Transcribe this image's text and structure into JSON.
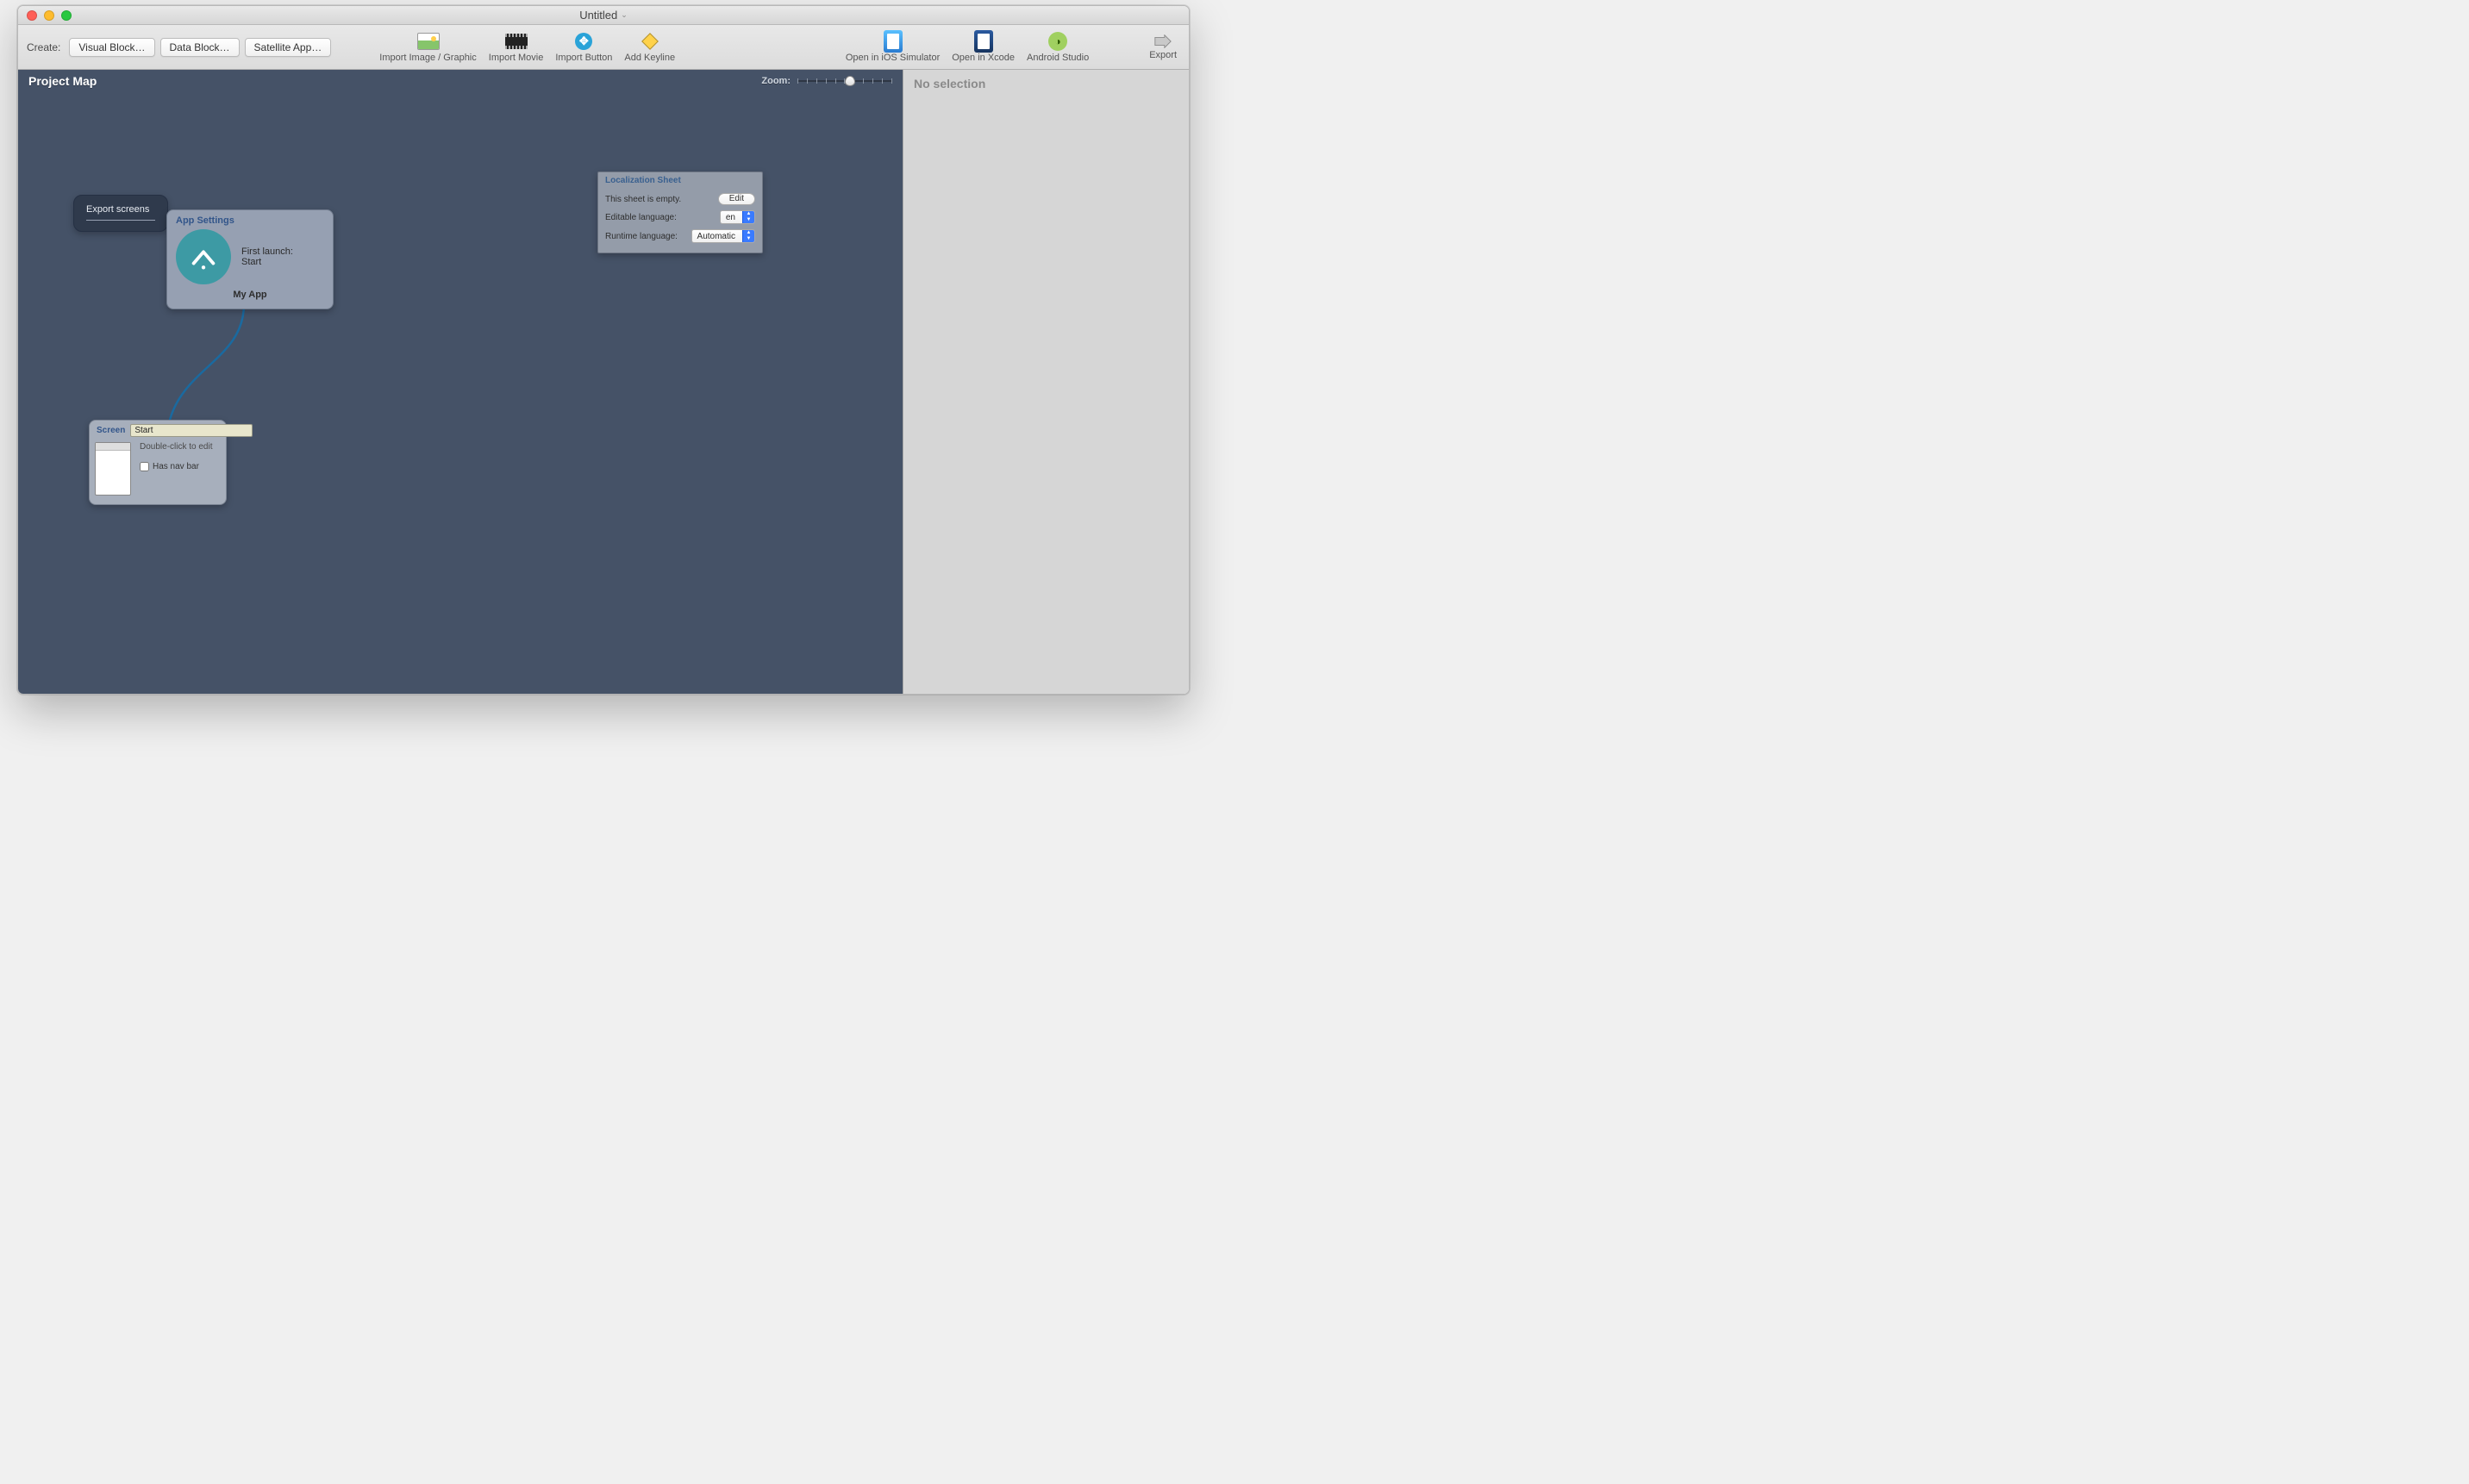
{
  "titlebar": {
    "title": "Untitled"
  },
  "toolbar": {
    "create_label": "Create:",
    "create_buttons": {
      "visual": "Visual Block…",
      "data": "Data Block…",
      "satellite": "Satellite App…"
    },
    "items": {
      "import_image": "Import Image / Graphic",
      "import_movie": "Import Movie",
      "import_button": "Import Button",
      "add_keyline": "Add Keyline",
      "open_ios": "Open in iOS Simulator",
      "open_xcode": "Open in Xcode",
      "android": "Android Studio",
      "export": "Export"
    }
  },
  "canvas": {
    "title": "Project Map",
    "zoom_label": "Zoom:",
    "zoom_thumb_pct": 55,
    "export_node": {
      "title": "Export screens"
    },
    "app_settings": {
      "header": "App Settings",
      "first_launch_label": "First launch:",
      "first_launch_value": "Start",
      "app_name": "My App"
    },
    "screen_node": {
      "header": "Screen",
      "name": "Start",
      "hint": "Double-click to edit",
      "has_nav_label": "Has nav bar",
      "has_nav": false
    },
    "localization": {
      "header": "Localization Sheet",
      "empty_text": "This sheet is empty.",
      "edit_btn": "Edit",
      "editable_lang_label": "Editable language:",
      "editable_lang_value": "en",
      "runtime_lang_label": "Runtime language:",
      "runtime_lang_value": "Automatic"
    }
  },
  "inspector": {
    "header": "No selection"
  }
}
